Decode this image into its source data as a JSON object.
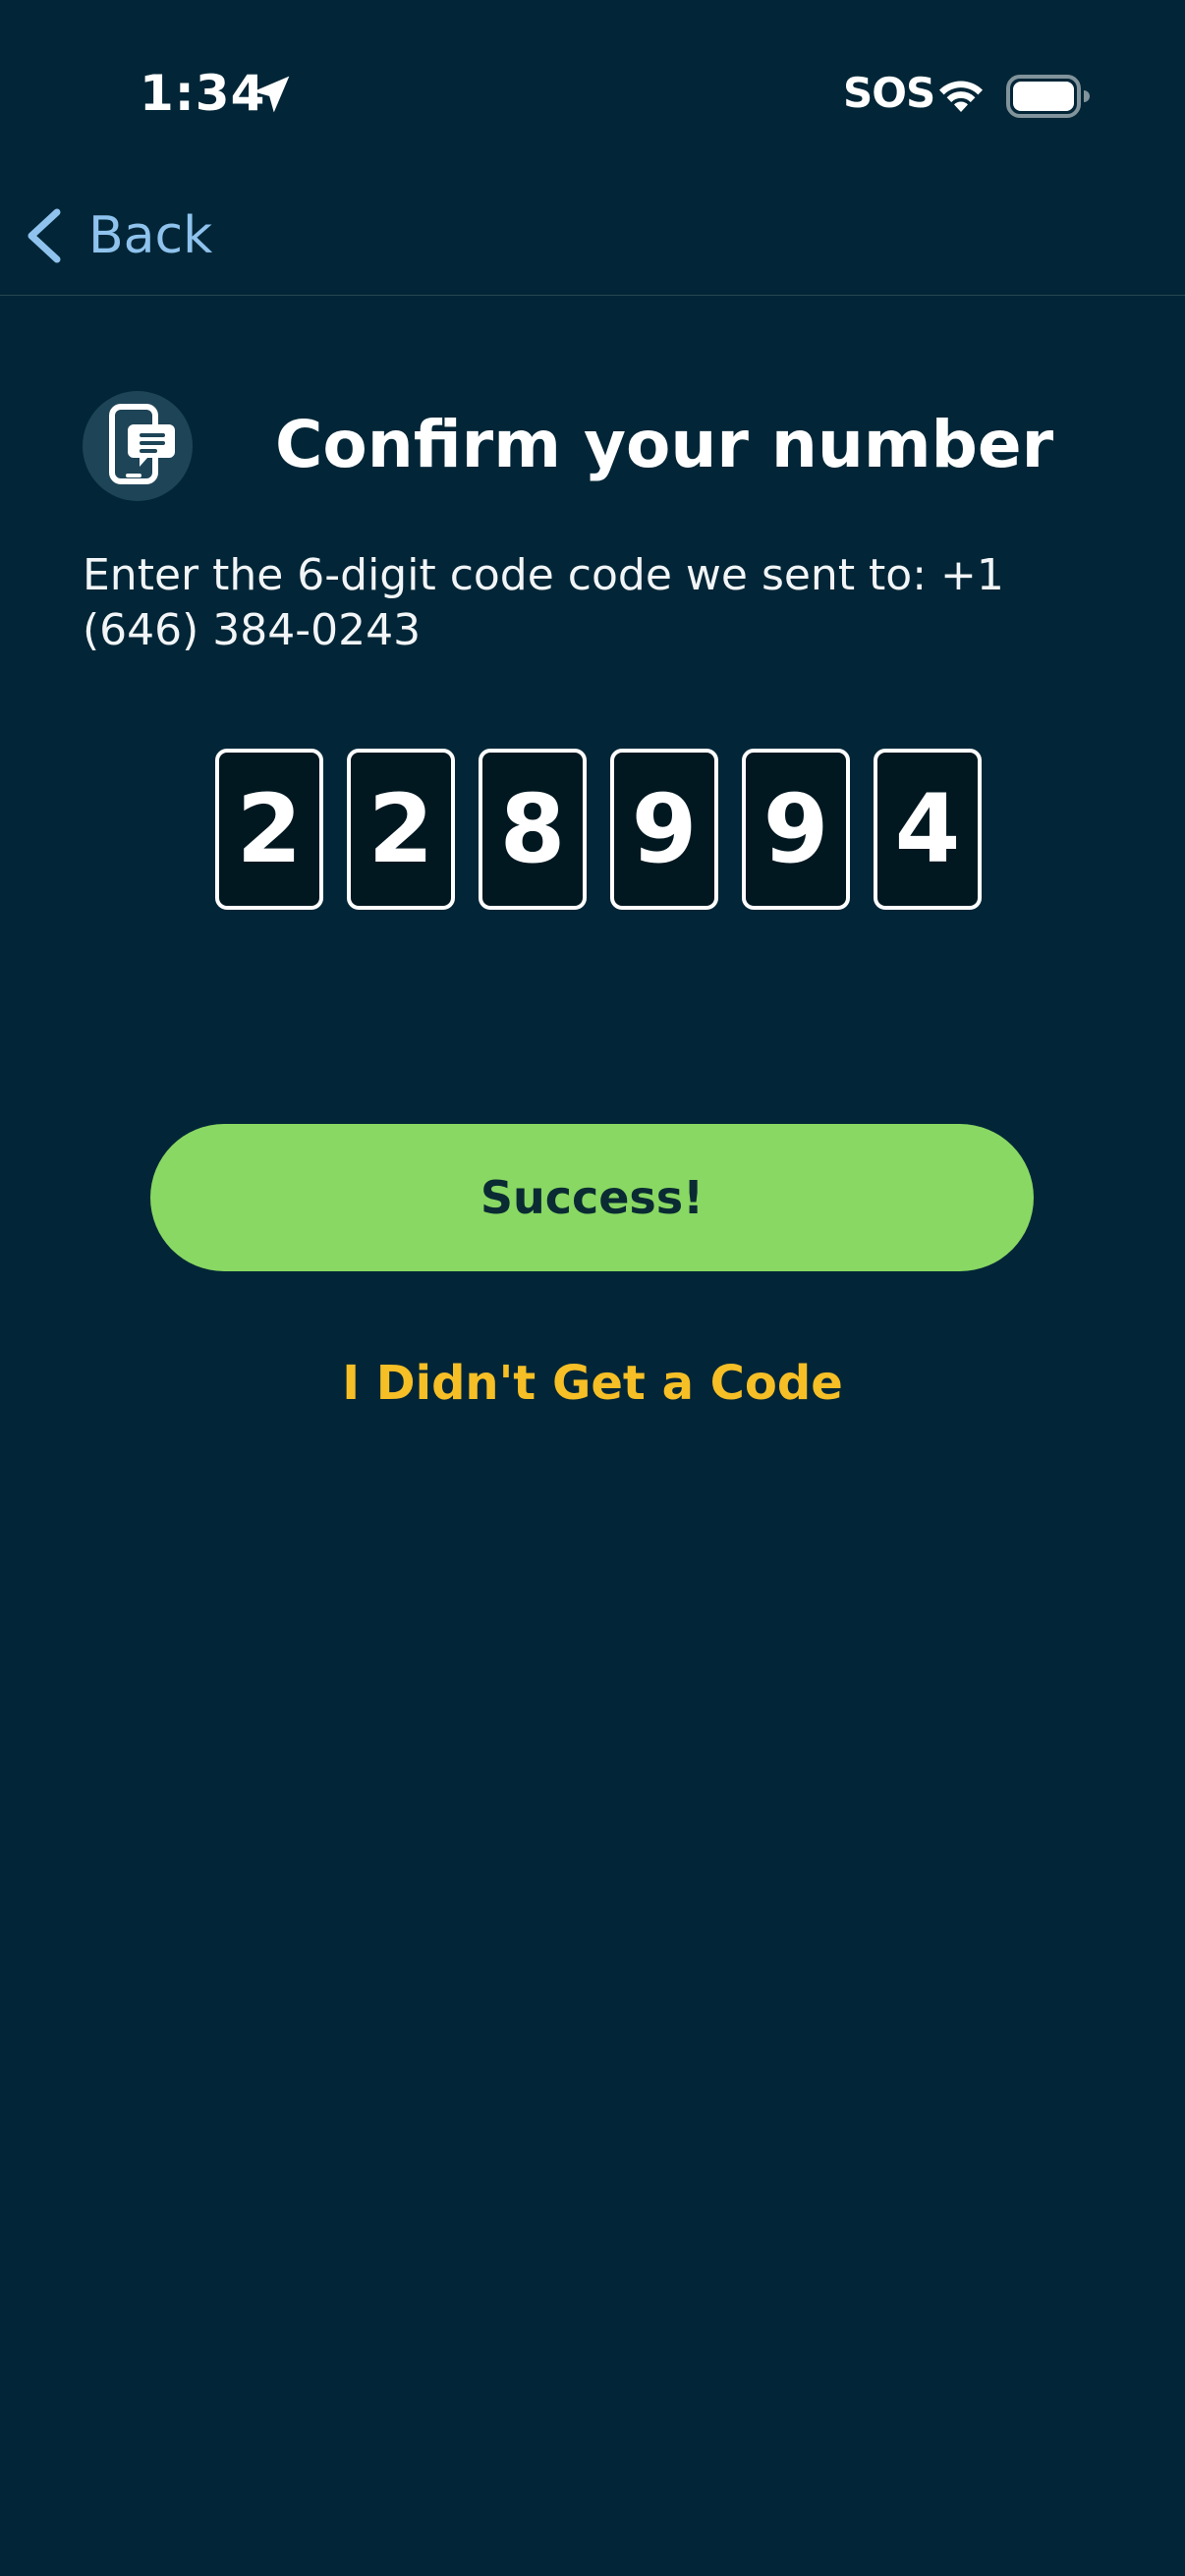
{
  "status_bar": {
    "time": "1:34",
    "sos": "SOS",
    "icons": [
      "location-arrow-icon",
      "wifi-icon",
      "battery-icon"
    ]
  },
  "nav": {
    "back_label": "Back"
  },
  "header": {
    "icon": "phone-message-icon",
    "title": "Confirm your number"
  },
  "instruction": "Enter the 6-digit code code we sent to: +1 (646) 384-0243",
  "code": [
    "2",
    "2",
    "8",
    "9",
    "9",
    "4"
  ],
  "actions": {
    "primary_label": "Success!",
    "secondary_label": "I Didn't Get a Code"
  },
  "colors": {
    "background": "#022637",
    "accent_green": "#89d863",
    "link_yellow": "#f6bf26",
    "back_blue": "#8fc3ee"
  }
}
